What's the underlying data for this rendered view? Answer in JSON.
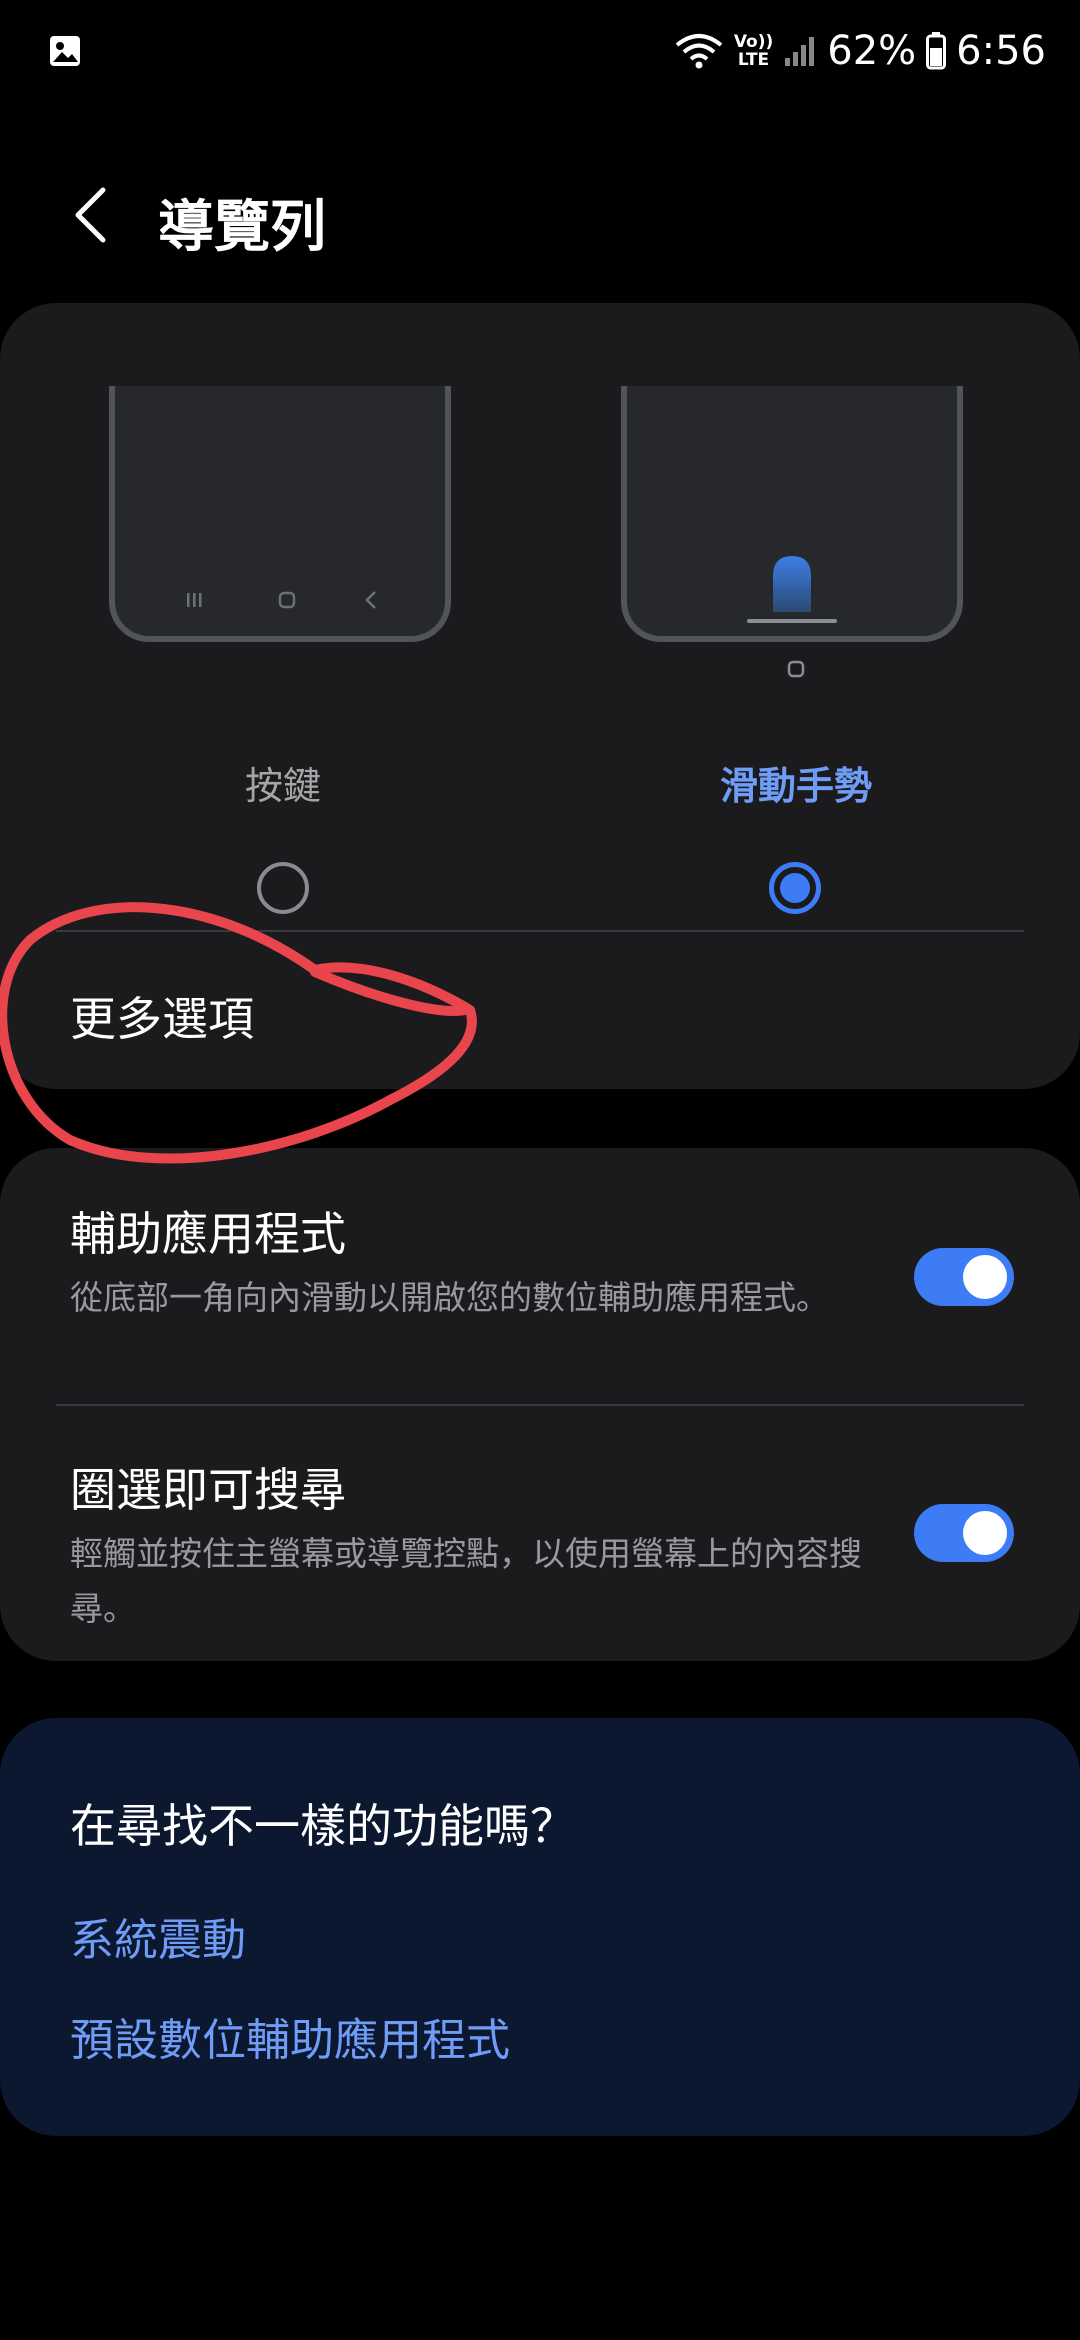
{
  "status_bar": {
    "volte_top": "Vo))",
    "volte_bottom": "LTE",
    "battery": "62%",
    "time": "6:56",
    "icons": [
      "gallery-icon",
      "wifi-icon",
      "signal-icon",
      "battery-icon"
    ]
  },
  "header": {
    "title": "導覽列",
    "back_icon": "chevron-left-icon"
  },
  "nav_type": {
    "options": [
      {
        "label": "按鍵",
        "selected": false
      },
      {
        "label": "滑動手勢",
        "selected": true
      }
    ],
    "more_options_label": "更多選項"
  },
  "toggles": [
    {
      "title": "輔助應用程式",
      "description": "從底部一角向內滑動以開啟您的數位輔助應用程式。",
      "on": true
    },
    {
      "title": "圈選即可搜尋",
      "description": "輕觸並按住主螢幕或導覽控點，以使用螢幕上的內容搜尋。",
      "on": true
    }
  ],
  "suggestions": {
    "title": "在尋找不一樣的功能嗎？",
    "links": [
      "系統震動",
      "預設數位輔助應用程式"
    ]
  },
  "colors": {
    "accent": "#3e7cf6",
    "link": "#6f9cf7",
    "card_bg": "#1b1b1d",
    "suggest_bg": "#0c1830",
    "annotation": "#e8454d"
  }
}
